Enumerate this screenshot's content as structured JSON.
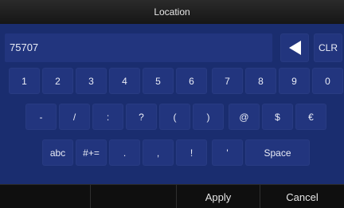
{
  "header": {
    "title": "Location"
  },
  "entry": {
    "value": "75707"
  },
  "keys": {
    "backspace_icon": "backspace-triangle-icon",
    "clear": "CLR",
    "row1": [
      "1",
      "2",
      "3",
      "4",
      "5",
      "6",
      "7",
      "8",
      "9",
      "0"
    ],
    "row2": [
      "-",
      "/",
      ":",
      "?",
      "(",
      ")",
      "@",
      "$",
      "€"
    ],
    "row3": [
      "abc",
      "#+=",
      ".",
      ",",
      "!",
      "'",
      "Space"
    ]
  },
  "footer": {
    "apply": "Apply",
    "cancel": "Cancel"
  },
  "colors": {
    "keyboard_bg": "#1a2d6f",
    "key_bg": "#22357e",
    "bar_bg": "#0f0f0f"
  }
}
